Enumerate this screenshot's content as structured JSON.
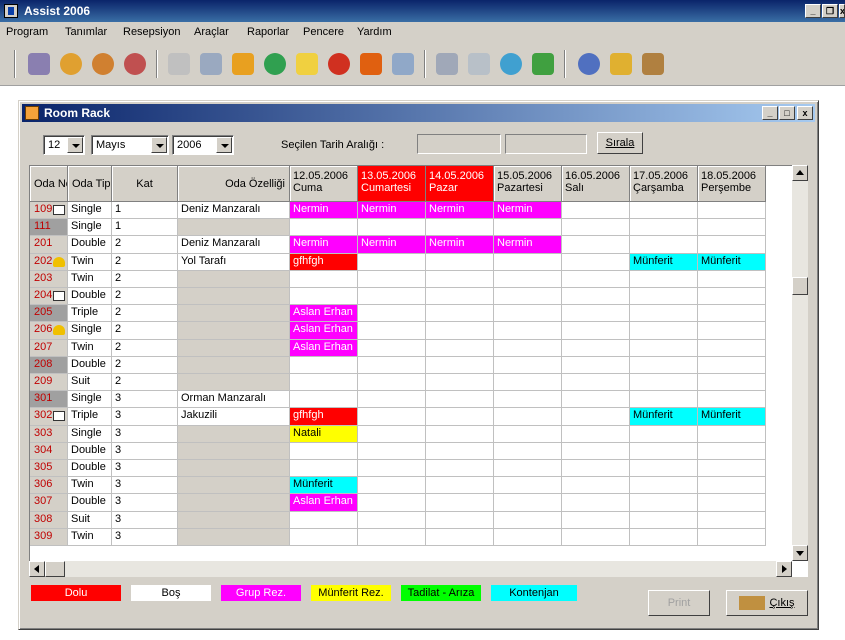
{
  "app": {
    "title": "Assist 2006"
  },
  "menu": [
    "Program",
    "Tanımlar",
    "Resepsiyon",
    "Araçlar",
    "Raporlar",
    "Pencere",
    "Yardım"
  ],
  "window": {
    "title": "Room Rack"
  },
  "filters": {
    "day": "12",
    "month": "Mayıs",
    "year": "2006",
    "range_label": "Seçilen Tarih Aralığı :",
    "range_start": "",
    "range_end": "",
    "sort_button": "Sırala"
  },
  "columns": {
    "room_no": "Oda No",
    "room_type": "Oda Tipi",
    "floor": "Kat",
    "features": "Oda Özelliği"
  },
  "dates": [
    {
      "date": "12.05.2006",
      "day": "Cuma",
      "highlight": false
    },
    {
      "date": "13.05.2006",
      "day": "Cumartesi",
      "highlight": true
    },
    {
      "date": "14.05.2006",
      "day": "Pazar",
      "highlight": true
    },
    {
      "date": "15.05.2006",
      "day": "Pazartesi",
      "highlight": false
    },
    {
      "date": "16.05.2006",
      "day": "Salı",
      "highlight": false
    },
    {
      "date": "17.05.2006",
      "day": "Çarşamba",
      "highlight": false
    },
    {
      "date": "18.05.2006",
      "day": "Perşembe",
      "highlight": false
    }
  ],
  "rooms": [
    {
      "no": "109",
      "icon": "mail",
      "type": "Single",
      "floor": "1",
      "feature": "Deniz Manzaralı",
      "grey": false,
      "bookings": [
        [
          "Nermin",
          "grup"
        ],
        [
          "Nermin",
          "grup"
        ],
        [
          "Nermin",
          "grup"
        ],
        [
          "Nermin",
          "grup"
        ],
        null,
        null,
        null
      ]
    },
    {
      "no": "111",
      "icon": "",
      "type": "Single",
      "floor": "1",
      "feature": "",
      "grey": true,
      "bookings": [
        null,
        null,
        null,
        null,
        null,
        null,
        null
      ]
    },
    {
      "no": "201",
      "icon": "",
      "type": "Double",
      "floor": "2",
      "feature": "Deniz Manzaralı",
      "grey": false,
      "bookings": [
        [
          "Nermin",
          "grup"
        ],
        [
          "Nermin",
          "grup"
        ],
        [
          "Nermin",
          "grup"
        ],
        [
          "Nermin",
          "grup"
        ],
        null,
        null,
        null
      ]
    },
    {
      "no": "202",
      "icon": "bell",
      "type": "Twin",
      "floor": "2",
      "feature": "Yol Tarafı",
      "grey": false,
      "bookings": [
        [
          "gfhfgh",
          "dolu"
        ],
        null,
        null,
        null,
        null,
        [
          "Münferit",
          "kontenjan"
        ],
        [
          "Münferit",
          "kontenjan"
        ]
      ]
    },
    {
      "no": "203",
      "icon": "",
      "type": "Twin",
      "floor": "2",
      "feature": "",
      "grey": false,
      "bookings": [
        null,
        null,
        null,
        null,
        null,
        null,
        null
      ]
    },
    {
      "no": "204",
      "icon": "mail",
      "type": "Double",
      "floor": "2",
      "feature": "",
      "grey": false,
      "bookings": [
        null,
        null,
        null,
        null,
        null,
        null,
        null
      ]
    },
    {
      "no": "205",
      "icon": "",
      "type": "Triple",
      "floor": "2",
      "feature": "",
      "grey": true,
      "bookings": [
        [
          "Aslan Erhan",
          "grup"
        ],
        null,
        null,
        null,
        null,
        null,
        null
      ]
    },
    {
      "no": "206",
      "icon": "bell",
      "type": "Single",
      "floor": "2",
      "feature": "",
      "grey": false,
      "bookings": [
        [
          "Aslan Erhan",
          "grup"
        ],
        null,
        null,
        null,
        null,
        null,
        null
      ]
    },
    {
      "no": "207",
      "icon": "",
      "type": "Twin",
      "floor": "2",
      "feature": "",
      "grey": false,
      "bookings": [
        [
          "Aslan Erhan",
          "grup"
        ],
        null,
        null,
        null,
        null,
        null,
        null
      ]
    },
    {
      "no": "208",
      "icon": "",
      "type": "Double",
      "floor": "2",
      "feature": "",
      "grey": true,
      "bookings": [
        null,
        null,
        null,
        null,
        null,
        null,
        null
      ]
    },
    {
      "no": "209",
      "icon": "",
      "type": "Suit",
      "floor": "2",
      "feature": "",
      "grey": false,
      "bookings": [
        null,
        null,
        null,
        null,
        null,
        null,
        null
      ]
    },
    {
      "no": "301",
      "icon": "",
      "type": "Single",
      "floor": "3",
      "feature": "Orman Manzaralı",
      "grey": true,
      "bookings": [
        null,
        null,
        null,
        null,
        null,
        null,
        null
      ]
    },
    {
      "no": "302",
      "icon": "mail",
      "type": "Triple",
      "floor": "3",
      "feature": "Jakuzili",
      "grey": false,
      "bookings": [
        [
          "gfhfgh",
          "dolu"
        ],
        null,
        null,
        null,
        null,
        [
          "Münferit",
          "kontenjan"
        ],
        [
          "Münferit",
          "kontenjan"
        ]
      ]
    },
    {
      "no": "303",
      "icon": "",
      "type": "Single",
      "floor": "3",
      "feature": "",
      "grey": false,
      "bookings": [
        [
          "Natali",
          "munferit"
        ],
        null,
        null,
        null,
        null,
        null,
        null
      ]
    },
    {
      "no": "304",
      "icon": "",
      "type": "Double",
      "floor": "3",
      "feature": "",
      "grey": false,
      "bookings": [
        null,
        null,
        null,
        null,
        null,
        null,
        null
      ]
    },
    {
      "no": "305",
      "icon": "",
      "type": "Double",
      "floor": "3",
      "feature": "",
      "grey": false,
      "bookings": [
        null,
        null,
        null,
        null,
        null,
        null,
        null
      ]
    },
    {
      "no": "306",
      "icon": "",
      "type": "Twin",
      "floor": "3",
      "feature": "",
      "grey": false,
      "bookings": [
        [
          "Münferit",
          "kontenjan"
        ],
        null,
        null,
        null,
        null,
        null,
        null
      ]
    },
    {
      "no": "307",
      "icon": "",
      "type": "Double",
      "floor": "3",
      "feature": "",
      "grey": false,
      "bookings": [
        [
          "Aslan Erhan",
          "grup"
        ],
        null,
        null,
        null,
        null,
        null,
        null
      ]
    },
    {
      "no": "308",
      "icon": "",
      "type": "Suit",
      "floor": "3",
      "feature": "",
      "grey": false,
      "bookings": [
        null,
        null,
        null,
        null,
        null,
        null,
        null
      ]
    },
    {
      "no": "309",
      "icon": "",
      "type": "Twin",
      "floor": "3",
      "feature": "",
      "grey": false,
      "bookings": [
        null,
        null,
        null,
        null,
        null,
        null,
        null
      ]
    }
  ],
  "legend": [
    {
      "key": "dolu",
      "label": "Dolu",
      "bg": "#ff0000",
      "fg": "#ffffff"
    },
    {
      "key": "bos",
      "label": "Boş",
      "bg": "#ffffff",
      "fg": "#000000"
    },
    {
      "key": "grup",
      "label": "Grup Rez.",
      "bg": "#ff00ff",
      "fg": "#ffffff"
    },
    {
      "key": "munferit",
      "label": "Münferit Rez.",
      "bg": "#ffff00",
      "fg": "#000000"
    },
    {
      "key": "tadilat",
      "label": "Tadilat - Arıza",
      "bg": "#00ff00",
      "fg": "#000000"
    },
    {
      "key": "kontenjan",
      "label": "Kontenjan",
      "bg": "#00ffff",
      "fg": "#000000"
    }
  ],
  "buttons": {
    "print": "Print",
    "exit": "Çıkış"
  },
  "colors": {
    "room_no_text": "#c00000",
    "grey_room": "#a0a0a0",
    "weekend_header": "#ff0000"
  }
}
